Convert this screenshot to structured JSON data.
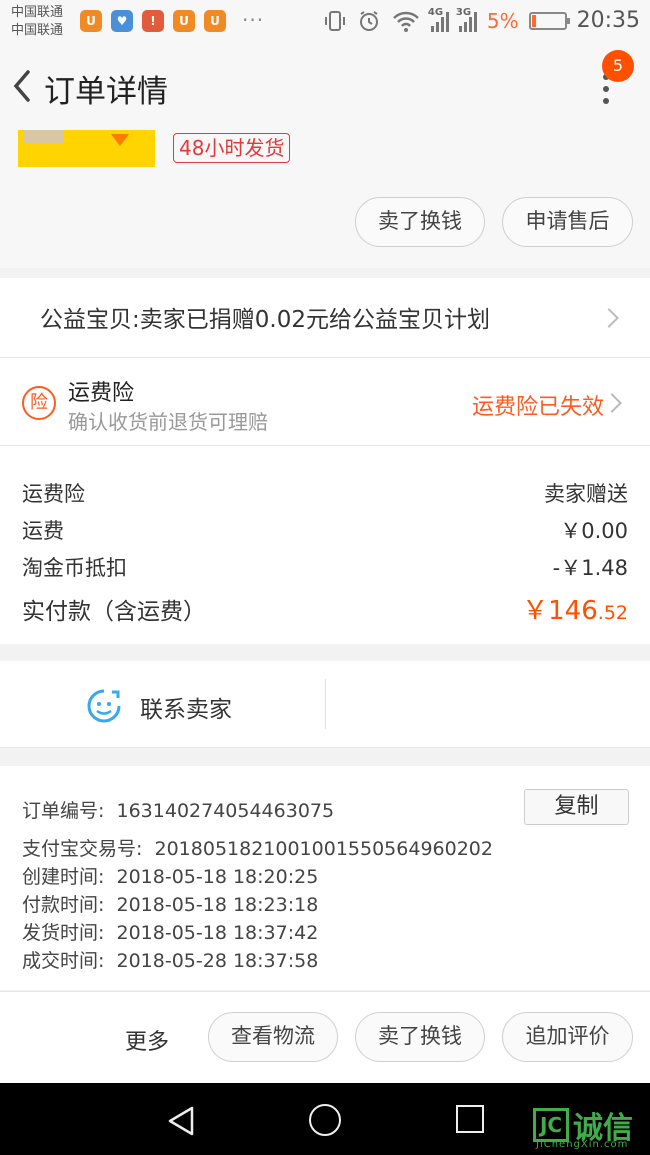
{
  "status_bar": {
    "carrier1": "中国联通",
    "carrier2": "中国联通",
    "dots": "···",
    "net1": "4G",
    "net2": "3G",
    "battery_pct": "5%",
    "time": "20:35"
  },
  "header": {
    "title": "订单详情",
    "badge": "5"
  },
  "product": {
    "ship_tag": "48小时发货",
    "btn_sell": "卖了换钱",
    "btn_aftersale": "申请售后"
  },
  "charity": {
    "text": "公益宝贝:卖家已捐赠0.02元给公益宝贝计划"
  },
  "insurance": {
    "icon_char": "险",
    "title": "运费险",
    "subtitle": "确认收货前退货可理赔",
    "status": "运费险已失效"
  },
  "costs": {
    "rows": [
      {
        "label": "运费险",
        "value": "卖家赠送"
      },
      {
        "label": "运费",
        "value": "￥0.00"
      },
      {
        "label": "淘金币抵扣",
        "value": "-￥1.48"
      }
    ],
    "paid_label": "实付款（含运费）",
    "paid_int": "￥146",
    "paid_dec": ".52"
  },
  "contact": {
    "label": "联系卖家"
  },
  "order_info": {
    "order_no_label": "订单编号:",
    "order_no": "163140274054463075",
    "copy_label": "复制",
    "alipay_label": "支付宝交易号:",
    "alipay_no": "2018051821001001550564960202",
    "created_label": "创建时间:",
    "created": "2018-05-18 18:20:25",
    "paid_label": "付款时间:",
    "paid": "2018-05-18 18:23:18",
    "shipped_label": "发货时间:",
    "shipped": "2018-05-18 18:37:42",
    "closed_label": "成交时间:",
    "closed": "2018-05-28 18:37:58"
  },
  "actions": {
    "more": "更多",
    "logistics": "查看物流",
    "sell": "卖了换钱",
    "review": "追加评价"
  },
  "watermark": {
    "box_char": "JC",
    "text": "诚信",
    "sub": "JiChengXin.com"
  },
  "colors": {
    "accent": "#ff5000",
    "tag_red": "#e4393c",
    "contact_blue": "#35a8f0",
    "watermark_green": "#3fae49"
  }
}
